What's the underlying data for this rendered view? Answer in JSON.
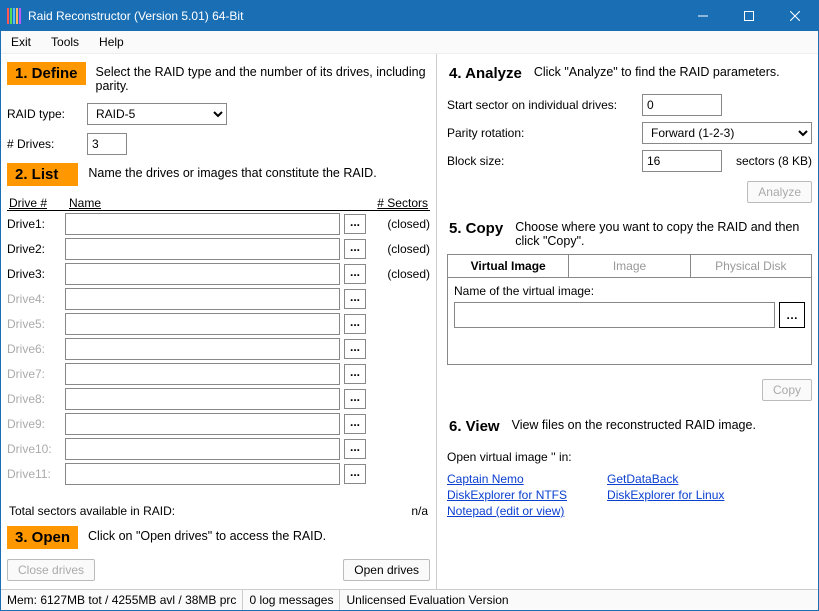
{
  "window": {
    "title": "Raid Reconstructor (Version 5.01) 64-Bit"
  },
  "menu": {
    "items": [
      "Exit",
      "Tools",
      "Help"
    ]
  },
  "step1": {
    "label": "1. Define",
    "desc": "Select the RAID type and the number of its drives, including parity.",
    "raid_type_label": "RAID type:",
    "raid_type_value": "RAID-5",
    "num_drives_label": "# Drives:",
    "num_drives_value": "3"
  },
  "step2": {
    "label": "2. List",
    "desc": "Name the drives or images that constitute the RAID.",
    "col_drive": "Drive #",
    "col_name": "Name",
    "col_sectors": "# Sectors",
    "drives": [
      {
        "label": "Drive1:",
        "status": "(closed)",
        "enabled": true
      },
      {
        "label": "Drive2:",
        "status": "(closed)",
        "enabled": true
      },
      {
        "label": "Drive3:",
        "status": "(closed)",
        "enabled": true
      },
      {
        "label": "Drive4:",
        "status": "",
        "enabled": false
      },
      {
        "label": "Drive5:",
        "status": "",
        "enabled": false
      },
      {
        "label": "Drive6:",
        "status": "",
        "enabled": false
      },
      {
        "label": "Drive7:",
        "status": "",
        "enabled": false
      },
      {
        "label": "Drive8:",
        "status": "",
        "enabled": false
      },
      {
        "label": "Drive9:",
        "status": "",
        "enabled": false
      },
      {
        "label": "Drive10:",
        "status": "",
        "enabled": false
      },
      {
        "label": "Drive11:",
        "status": "",
        "enabled": false
      }
    ],
    "total_label": "Total sectors available in RAID:",
    "total_value": "n/a"
  },
  "step3": {
    "label": "3. Open",
    "desc": "Click on \"Open drives\" to access the RAID.",
    "close_btn": "Close drives",
    "open_btn": "Open drives"
  },
  "step4": {
    "label": "4. Analyze",
    "desc": "Click \"Analyze\" to find the RAID parameters.",
    "start_sector_label": "Start sector on individual drives:",
    "start_sector_value": "0",
    "parity_label": "Parity rotation:",
    "parity_value": "Forward (1-2-3)",
    "block_label": "Block size:",
    "block_value": "16",
    "block_suffix": "sectors (8 KB)",
    "analyze_btn": "Analyze"
  },
  "step5": {
    "label": "5. Copy",
    "desc": "Choose where you want to copy the RAID and then click \"Copy\".",
    "tabs": [
      "Virtual Image",
      "Image",
      "Physical Disk"
    ],
    "vi_label": "Name of the virtual image:",
    "copy_btn": "Copy"
  },
  "step6": {
    "label": "6. View",
    "desc": "View files on the reconstructed RAID image.",
    "open_in_label": "Open virtual image '' in:",
    "links_left": [
      "Captain Nemo",
      "DiskExplorer for NTFS",
      "Notepad (edit or view)"
    ],
    "links_right": [
      "GetDataBack",
      "DiskExplorer for Linux"
    ]
  },
  "statusbar": {
    "mem": "Mem: 6127MB tot / 4255MB avl / 38MB prc",
    "log": "0 log messages",
    "lic": "Unlicensed Evaluation Version"
  }
}
